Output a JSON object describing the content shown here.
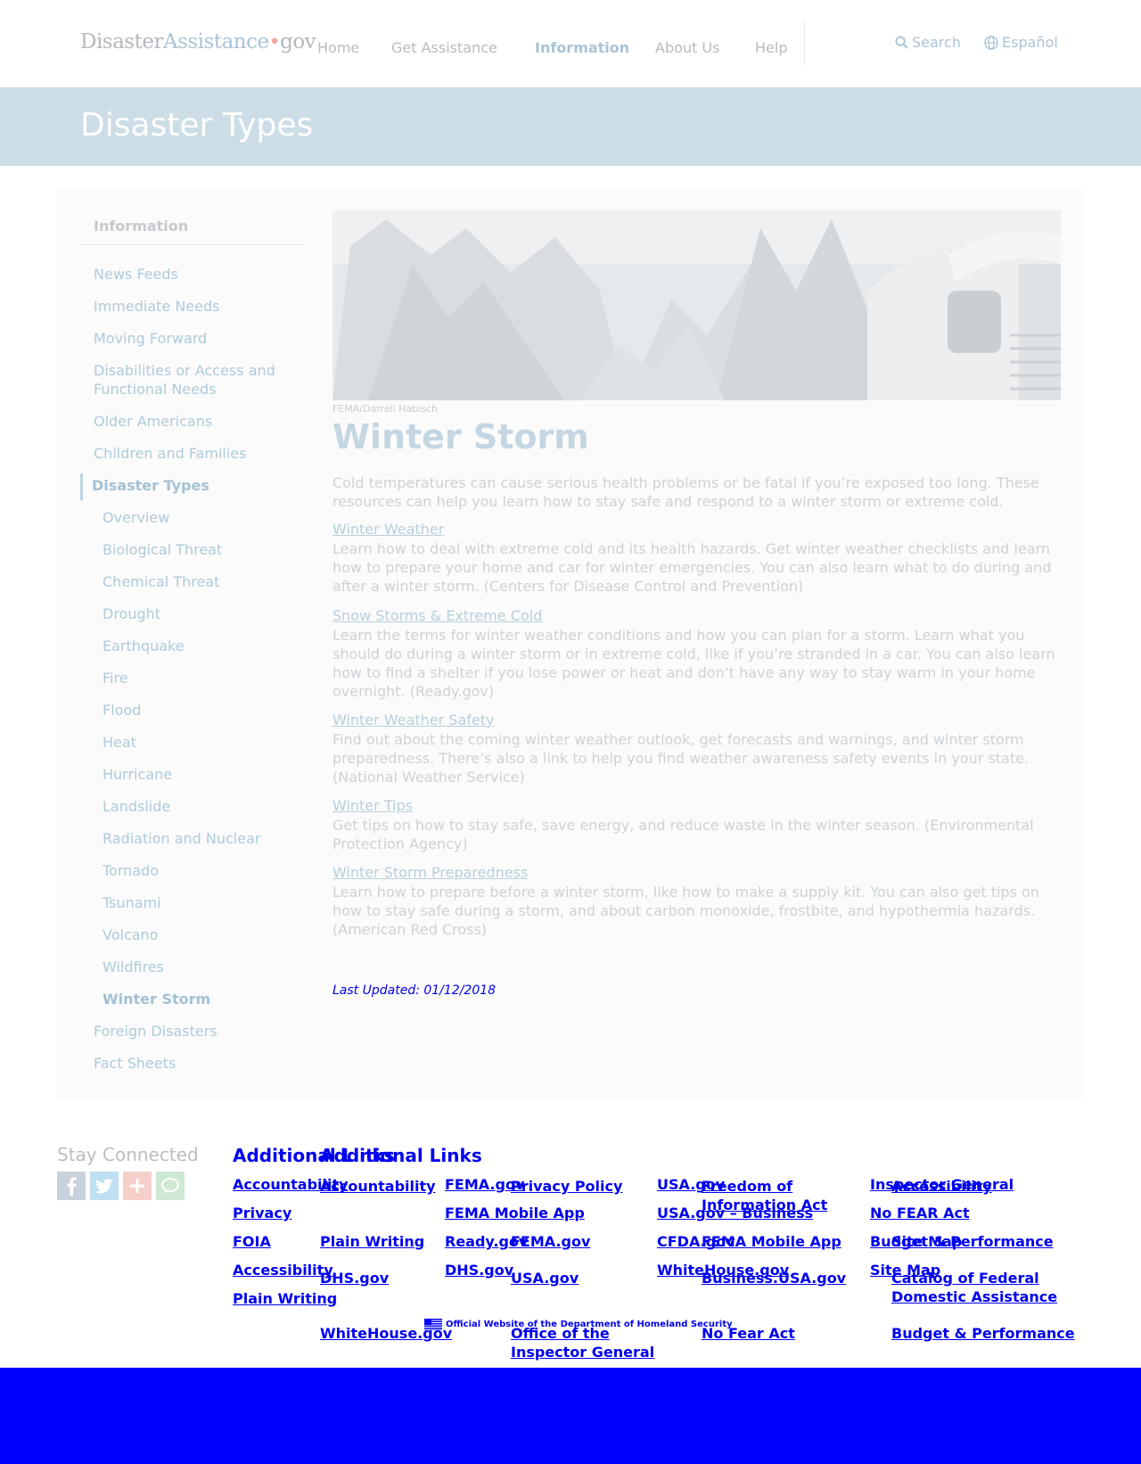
{
  "header": {
    "logo": {
      "part1": "Disaster",
      "part2": "Assistance",
      "dot": "•",
      "part3": "gov"
    },
    "nav": [
      "Home",
      "Get Assistance",
      "Information",
      "About Us",
      "Help"
    ],
    "search_label": "Search",
    "language_label": "Español"
  },
  "banner": {
    "title": "Disaster Types"
  },
  "sidebar": {
    "title": "Information",
    "items": [
      "News Feeds",
      "Immediate Needs",
      "Moving Forward",
      "Disabilities or Access and Functional Needs",
      "Older Americans",
      "Children and Families",
      "Disaster Types",
      "Foreign Disasters",
      "Fact Sheets"
    ],
    "subitems": [
      "Overview",
      "Biological Threat",
      "Chemical Threat",
      "Drought",
      "Earthquake",
      "Fire",
      "Flood",
      "Heat",
      "Hurricane",
      "Landslide",
      "Radiation and Nuclear",
      "Tornado",
      "Tsunami",
      "Volcano",
      "Wildfires",
      "Winter Storm"
    ]
  },
  "main": {
    "photo_credit": "FEMA/Darrell Habisch",
    "title": "Winter Storm",
    "intro": "Cold temperatures can cause serious health problems or be fatal if you’re exposed too long. These resources can help you learn how to stay safe and respond to a winter storm or extreme cold.",
    "resources": [
      {
        "link": "Winter Weather",
        "desc": "Learn how to deal with extreme cold and its health hazards. Get winter weather checklists and learn how to prepare your home and car for winter emergencies. You can also learn what to do during and after a winter storm. (Centers for Disease Control and Prevention)"
      },
      {
        "link": "Snow Storms & Extreme Cold",
        "desc": "Learn the terms for winter weather conditions and how you can plan for a storm. Learn what you should do during a winter storm or in extreme cold, like if you’re stranded in a car. You can also learn how to find a shelter if you lose power or heat and don’t have any way to stay warm in your home overnight. (Ready.gov)"
      },
      {
        "link": "Winter Weather Safety",
        "desc": "Find out about the coming winter weather outlook, get forecasts and warnings, and winter storm preparedness. There’s also a link to help you find weather awareness safety events in your state. (National Weather Service)"
      },
      {
        "link": "Winter Tips",
        "desc": "Get tips on how to stay safe, save energy, and reduce waste in the winter season. (Environmental Protection Agency)"
      },
      {
        "link": "Winter Storm Preparedness",
        "desc": "Learn how to prepare before a winter storm, like how to make a supply kit. You can also get tips on how to stay safe during a storm, and about carbon monoxide, frostbite, and hypothermia hazards. (American Red Cross)"
      }
    ],
    "last_updated": "Last Updated: 01/12/2018"
  },
  "footer": {
    "stay_connected": "Stay Connected",
    "social_icons": [
      "facebook-icon",
      "twitter-icon",
      "google-plus-icon",
      "chat-icon"
    ],
    "heading_a": "Additional Links",
    "heading_b": "Additional Links",
    "links_a": [
      "Accountability",
      "Privacy",
      "FOIA",
      "Accessibility",
      "Plain Writing",
      "FEMA.gov",
      "FEMA Mobile App",
      "Ready.gov",
      "DHS.gov",
      "USA.gov",
      "USA.gov – Business",
      "CFDA.gov",
      "WhiteHouse.gov",
      "Inspector General",
      "No FEAR Act",
      "Budget & Performance",
      "Site Map"
    ],
    "links_b": [
      "Accountability",
      "Plain Writing",
      "DHS.gov",
      "WhiteHouse.gov",
      "Privacy Policy",
      "FEMA.gov",
      "USA.gov",
      "Office of the Inspector General",
      "Freedom of Information Act",
      "FEMA Mobile App",
      "Business.USA.gov",
      "No Fear Act",
      "Accessibility",
      "Site Map",
      "Catalog of Federal Domestic Assistance",
      "Budget & Performance"
    ],
    "official": "Official Website of the Department of Homeland Security"
  },
  "colors": {
    "banner": "#ccdde6",
    "link_blue": "#0000ee",
    "bottom_bar": "#0000ff"
  }
}
